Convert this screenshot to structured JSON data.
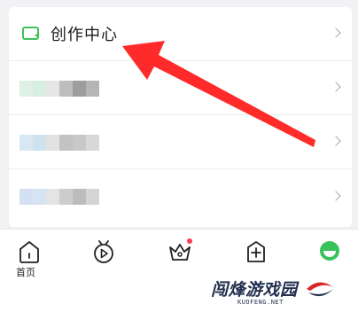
{
  "menu": {
    "creation_center": {
      "label": "创作中心",
      "icon": "video-camera-icon",
      "icon_color": "#3fc25a"
    },
    "blurred_rows": [
      {
        "colors": [
          "#dff0e6",
          "#d9eee2",
          "#e6e6e6",
          "#bdbdbd",
          "#9d9d9d",
          "#b5b5b5"
        ]
      },
      {
        "colors": [
          "#d7e8f3",
          "#cfe3ef",
          "#e2e2e2",
          "#c2c2c2",
          "#c8c8c8",
          "#d8d8d8"
        ]
      },
      {
        "colors": [
          "#d3e1f3",
          "#d6e4f2",
          "#e4e4e4",
          "#cdcdcd",
          "#bdbdbd",
          "#d4d4d4"
        ]
      }
    ],
    "chevron_icon": "chevron-right-icon"
  },
  "tabbar": {
    "tabs": [
      {
        "label": "首页",
        "icon": "home-icon"
      },
      {
        "label": "",
        "icon": "tv-play-icon"
      },
      {
        "label": "",
        "icon": "crown-icon",
        "badge_color": "#ff3c55"
      },
      {
        "label": "",
        "icon": "plus-square-icon"
      },
      {
        "label": "",
        "icon": "avatar-icon",
        "color": "#38c25c"
      }
    ]
  },
  "annotation": {
    "color": "#ff2a2a",
    "icon": "red-arrow"
  },
  "watermark": {
    "text": "闯烽游戏园",
    "subtext": "KUOFENG.NET",
    "logo": "swoosh-logo"
  }
}
